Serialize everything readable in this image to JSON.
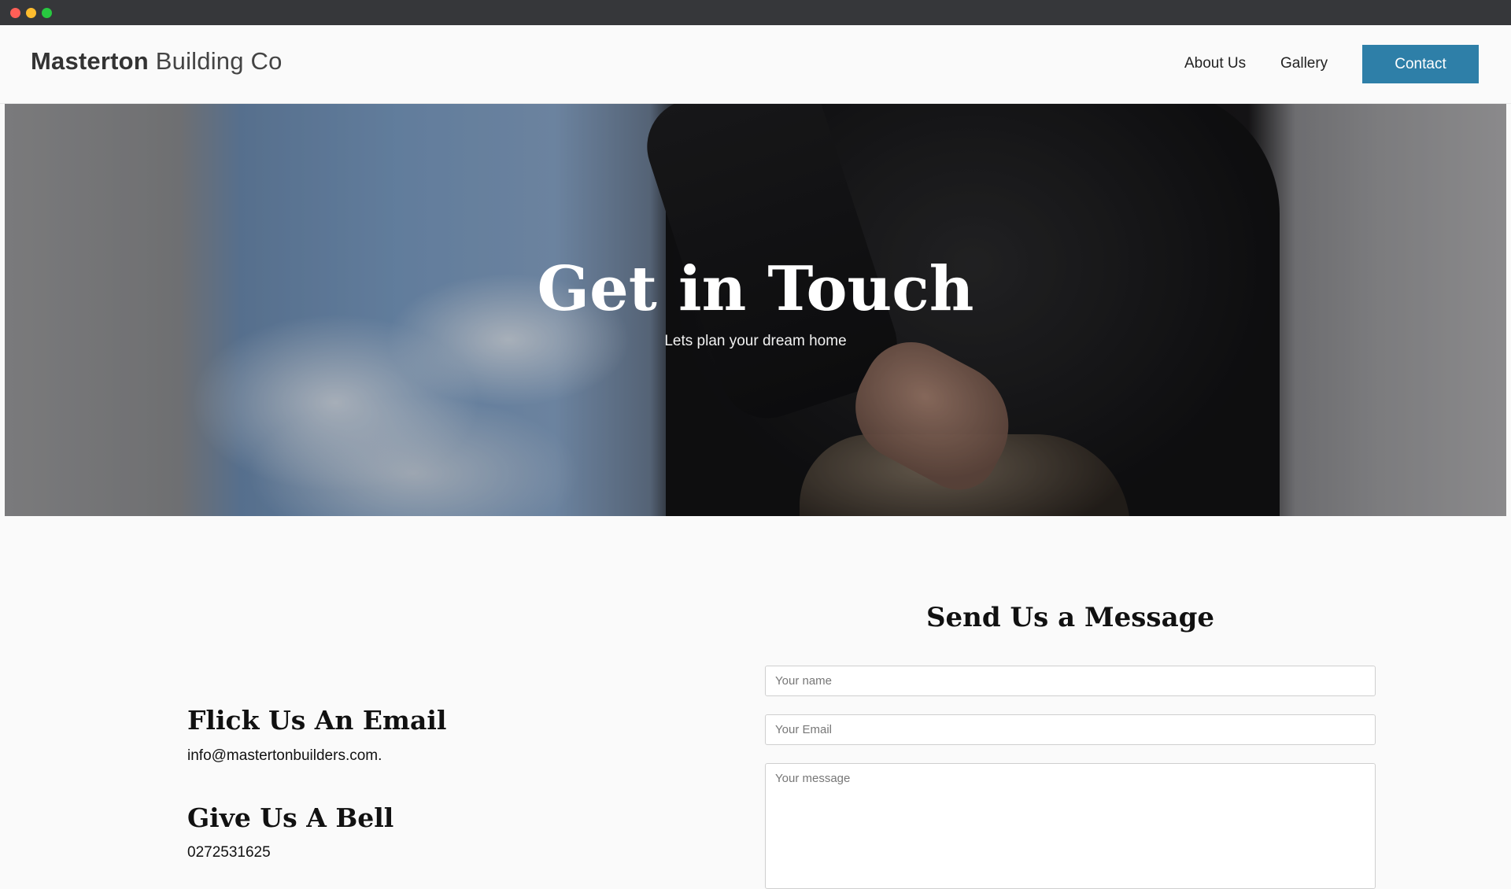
{
  "brand": {
    "bold": "Masterton",
    "rest": "Building Co"
  },
  "nav": {
    "about": "About Us",
    "gallery": "Gallery",
    "contact": "Contact"
  },
  "hero": {
    "title": "Get in Touch",
    "subtitle": "Lets plan your dream home"
  },
  "form": {
    "title": "Send Us a Message",
    "name_placeholder": "Your name",
    "email_placeholder": "Your Email",
    "message_placeholder": "Your message"
  },
  "contact_info": {
    "email_heading": "Flick Us An Email",
    "email": "info@mastertonbuilders.com.",
    "phone_heading": "Give Us A Bell",
    "phone": "0272531625"
  },
  "colors": {
    "accent": "#2e7fa8",
    "titlebar": "#36373a"
  }
}
